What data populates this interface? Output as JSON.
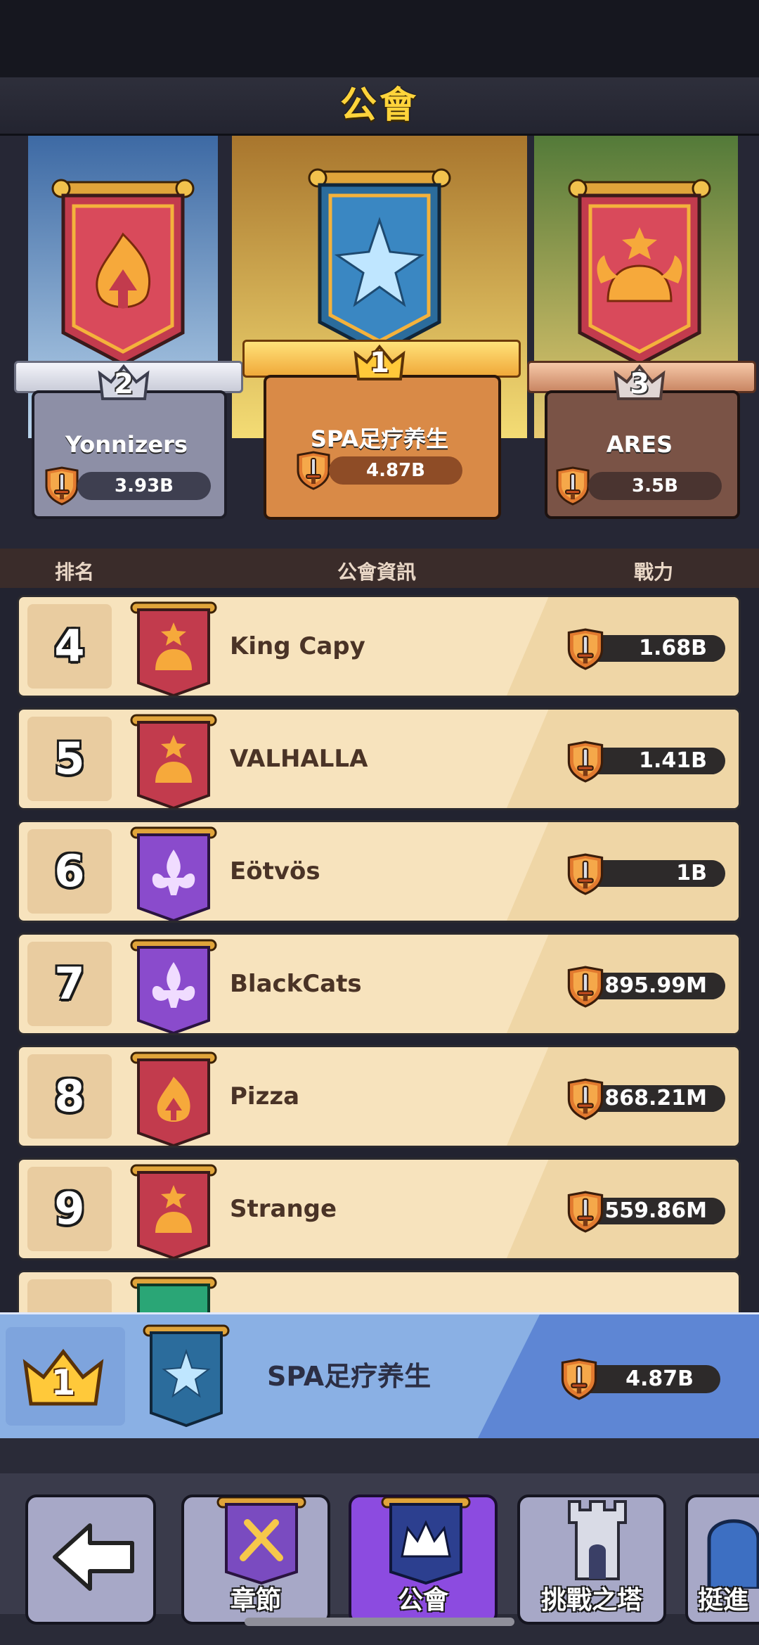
{
  "header": {
    "title": "公會"
  },
  "podium": [
    {
      "rank": "2",
      "name": "Yonnizers",
      "power": "3.93B"
    },
    {
      "rank": "1",
      "name": "SPA足疗养生",
      "power": "4.87B"
    },
    {
      "rank": "3",
      "name": "ARES",
      "power": "3.5B"
    }
  ],
  "columns": {
    "rank": "排名",
    "info": "公會資訊",
    "power": "戰力"
  },
  "rows": [
    {
      "rank": "4",
      "name": "King Capy",
      "power": "1.68B",
      "banner": "red-viking-banner"
    },
    {
      "rank": "5",
      "name": "VALHALLA",
      "power": "1.41B",
      "banner": "red-viking-banner"
    },
    {
      "rank": "6",
      "name": "Eötvös",
      "power": "1B",
      "banner": "purple-fleur-banner"
    },
    {
      "rank": "7",
      "name": "BlackCats",
      "power": "895.99M",
      "banner": "purple-fleur-banner"
    },
    {
      "rank": "8",
      "name": "Pizza",
      "power": "868.21M",
      "banner": "red-flame-banner"
    },
    {
      "rank": "9",
      "name": "Strange",
      "power": "559.86M",
      "banner": "red-viking-banner"
    }
  ],
  "my_guild": {
    "rank": "1",
    "name": "SPA足疗养生",
    "power": "4.87B"
  },
  "nav": {
    "chapter": "章節",
    "guild": "公會",
    "tower": "挑戰之塔",
    "advance": "挺進"
  },
  "colors": {
    "gold": "#ffd43b",
    "row_bg": "#f7e3bd",
    "my_bar": "#8ab0e4",
    "active_tab": "#8c4be0"
  }
}
